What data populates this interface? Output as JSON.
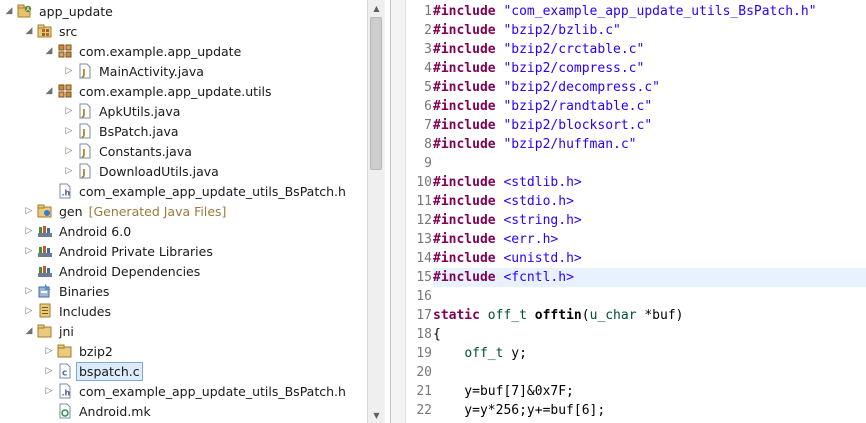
{
  "explorer": {
    "rows": [
      {
        "label": "app_update",
        "icon": "project-icon",
        "arrow": "expanded"
      },
      {
        "label": "src",
        "icon": "source-folder-icon",
        "arrow": "expanded"
      },
      {
        "label": "com.example.app_update",
        "icon": "package-icon",
        "arrow": "expanded"
      },
      {
        "label": "MainActivity.java",
        "icon": "java-file-icon",
        "arrow": "collapsed"
      },
      {
        "label": "com.example.app_update.utils",
        "icon": "package-icon",
        "arrow": "expanded"
      },
      {
        "label": "ApkUtils.java",
        "icon": "java-file-icon",
        "arrow": "collapsed"
      },
      {
        "label": "BsPatch.java",
        "icon": "java-file-icon",
        "arrow": "collapsed"
      },
      {
        "label": "Constants.java",
        "icon": "java-file-icon",
        "arrow": "collapsed"
      },
      {
        "label": "DownloadUtils.java",
        "icon": "java-file-icon",
        "arrow": "collapsed"
      },
      {
        "label": "com_example_app_update_utils_BsPatch.h",
        "icon": "c-header-file-icon",
        "arrow": "none"
      },
      {
        "label": "gen",
        "decoration": "[Generated Java Files]",
        "icon": "gen-folder-icon",
        "arrow": "collapsed"
      },
      {
        "label": "Android 6.0",
        "icon": "library-icon",
        "arrow": "collapsed"
      },
      {
        "label": "Android Private Libraries",
        "icon": "library-icon",
        "arrow": "collapsed"
      },
      {
        "label": "Android Dependencies",
        "icon": "library-icon",
        "arrow": "none"
      },
      {
        "label": "Binaries",
        "icon": "binaries-icon",
        "arrow": "collapsed"
      },
      {
        "label": "Includes",
        "icon": "includes-icon",
        "arrow": "collapsed"
      },
      {
        "label": "jni",
        "icon": "folder-icon",
        "arrow": "expanded"
      },
      {
        "label": "bzip2",
        "icon": "folder-icon",
        "arrow": "collapsed"
      },
      {
        "label": "bspatch.c",
        "icon": "c-source-file-icon",
        "arrow": "collapsed",
        "selected": true
      },
      {
        "label": "com_example_app_update_utils_BsPatch.h",
        "icon": "c-header-file-icon",
        "arrow": "collapsed"
      },
      {
        "label": "Android.mk",
        "icon": "makefile-icon",
        "arrow": "none"
      }
    ]
  },
  "editor": {
    "current_line": 15,
    "lines": [
      {
        "num": "1",
        "tokens": [
          {
            "t": "#include",
            "c": "kw"
          },
          {
            "t": " ",
            "c": "plain"
          },
          {
            "t": "\"com_example_app_update_utils_BsPatch.h\"",
            "c": "str"
          }
        ]
      },
      {
        "num": "2",
        "tokens": [
          {
            "t": "#include",
            "c": "kw"
          },
          {
            "t": " ",
            "c": "plain"
          },
          {
            "t": "\"bzip2/bzlib.c\"",
            "c": "str"
          }
        ]
      },
      {
        "num": "3",
        "tokens": [
          {
            "t": "#include",
            "c": "kw"
          },
          {
            "t": " ",
            "c": "plain"
          },
          {
            "t": "\"bzip2/crctable.c\"",
            "c": "str"
          }
        ]
      },
      {
        "num": "4",
        "tokens": [
          {
            "t": "#include",
            "c": "kw"
          },
          {
            "t": " ",
            "c": "plain"
          },
          {
            "t": "\"bzip2/compress.c\"",
            "c": "str"
          }
        ]
      },
      {
        "num": "5",
        "tokens": [
          {
            "t": "#include",
            "c": "kw"
          },
          {
            "t": " ",
            "c": "plain"
          },
          {
            "t": "\"bzip2/decompress.c\"",
            "c": "str"
          }
        ]
      },
      {
        "num": "6",
        "tokens": [
          {
            "t": "#include",
            "c": "kw"
          },
          {
            "t": " ",
            "c": "plain"
          },
          {
            "t": "\"bzip2/randtable.c\"",
            "c": "str"
          }
        ]
      },
      {
        "num": "7",
        "tokens": [
          {
            "t": "#include",
            "c": "kw"
          },
          {
            "t": " ",
            "c": "plain"
          },
          {
            "t": "\"bzip2/blocksort.c\"",
            "c": "str"
          }
        ]
      },
      {
        "num": "8",
        "tokens": [
          {
            "t": "#include",
            "c": "kw"
          },
          {
            "t": " ",
            "c": "plain"
          },
          {
            "t": "\"bzip2/huffman.c\"",
            "c": "str"
          }
        ]
      },
      {
        "num": "9",
        "tokens": []
      },
      {
        "num": "10",
        "tokens": [
          {
            "t": "#include",
            "c": "kw"
          },
          {
            "t": " ",
            "c": "plain"
          },
          {
            "t": "<stdlib.h>",
            "c": "str"
          }
        ]
      },
      {
        "num": "11",
        "tokens": [
          {
            "t": "#include",
            "c": "kw"
          },
          {
            "t": " ",
            "c": "plain"
          },
          {
            "t": "<stdio.h>",
            "c": "str"
          }
        ]
      },
      {
        "num": "12",
        "tokens": [
          {
            "t": "#include",
            "c": "kw"
          },
          {
            "t": " ",
            "c": "plain"
          },
          {
            "t": "<string.h>",
            "c": "str"
          }
        ]
      },
      {
        "num": "13",
        "tokens": [
          {
            "t": "#include",
            "c": "kw"
          },
          {
            "t": " ",
            "c": "plain"
          },
          {
            "t": "<err.h>",
            "c": "str"
          }
        ]
      },
      {
        "num": "14",
        "tokens": [
          {
            "t": "#include",
            "c": "kw"
          },
          {
            "t": " ",
            "c": "plain"
          },
          {
            "t": "<unistd.h>",
            "c": "str"
          }
        ]
      },
      {
        "num": "15",
        "tokens": [
          {
            "t": "#include",
            "c": "kw"
          },
          {
            "t": " ",
            "c": "plain"
          },
          {
            "t": "<fcntl.h>",
            "c": "str"
          }
        ]
      },
      {
        "num": "16",
        "tokens": []
      },
      {
        "num": "17",
        "tokens": [
          {
            "t": "static",
            "c": "kw"
          },
          {
            "t": " ",
            "c": "plain"
          },
          {
            "t": "off_t",
            "c": "type"
          },
          {
            "t": " ",
            "c": "plain"
          },
          {
            "t": "offtin",
            "c": "fn"
          },
          {
            "t": "(",
            "c": "plain"
          },
          {
            "t": "u_char",
            "c": "type"
          },
          {
            "t": " *buf)",
            "c": "plain"
          }
        ]
      },
      {
        "num": "18",
        "tokens": [
          {
            "t": "{",
            "c": "plain"
          }
        ]
      },
      {
        "num": "19",
        "tokens": [
          {
            "t": "    ",
            "c": "plain"
          },
          {
            "t": "off_t",
            "c": "type"
          },
          {
            "t": " y;",
            "c": "plain"
          }
        ]
      },
      {
        "num": "20",
        "tokens": []
      },
      {
        "num": "21",
        "tokens": [
          {
            "t": "    y=buf[7]&0x7F;",
            "c": "plain"
          }
        ]
      },
      {
        "num": "22",
        "tokens": [
          {
            "t": "    y=y*256;y+=buf[6];",
            "c": "plain"
          }
        ]
      }
    ]
  },
  "colors": {
    "keyword": "#7f0055",
    "string": "#2a00ff",
    "type": "#005032",
    "line_number": "#787878",
    "current_line_bg": "#e8f2fe",
    "selection_bg": "#dceaf9"
  }
}
